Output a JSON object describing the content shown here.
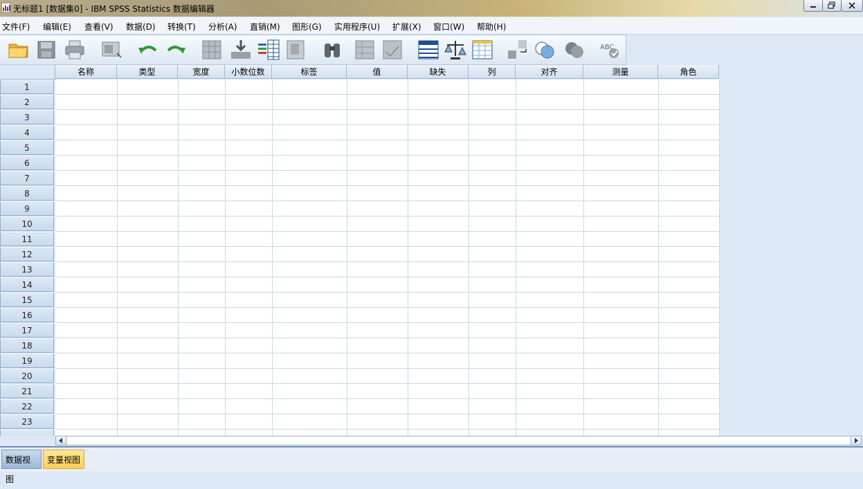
{
  "window": {
    "title": "无标题1 [数据集0] - IBM SPSS Statistics 数据编辑器"
  },
  "menu": [
    {
      "label": "文件(F)"
    },
    {
      "label": "编辑(E)"
    },
    {
      "label": "查看(V)"
    },
    {
      "label": "数据(D)"
    },
    {
      "label": "转换(T)"
    },
    {
      "label": "分析(A)"
    },
    {
      "label": "直销(M)"
    },
    {
      "label": "图形(G)"
    },
    {
      "label": "实用程序(U)"
    },
    {
      "label": "扩展(X)"
    },
    {
      "label": "窗口(W)"
    },
    {
      "label": "帮助(H)"
    }
  ],
  "toolbar": [
    "open-folder-icon",
    "save-icon",
    "print-icon",
    "dialog-recall-icon",
    "undo-icon",
    "redo-icon",
    "goto-case-icon",
    "goto-variable-icon",
    "variables-icon",
    "run-descriptives-icon",
    "find-icon",
    "insert-cases-icon",
    "insert-variable-icon",
    "split-file-icon",
    "weight-cases-icon",
    "select-cases-icon",
    "value-labels-icon",
    "use-variable-sets-icon",
    "show-all-variables-icon",
    "spell-check-icon"
  ],
  "grid": {
    "columns": [
      "名称",
      "类型",
      "宽度",
      "小数位数",
      "标签",
      "值",
      "缺失",
      "列",
      "对齐",
      "测量",
      "角色"
    ],
    "rows": [
      "1",
      "2",
      "3",
      "4",
      "5",
      "6",
      "7",
      "8",
      "9",
      "10",
      "11",
      "12",
      "13",
      "14",
      "15",
      "16",
      "17",
      "18",
      "19",
      "20",
      "21",
      "22",
      "23"
    ]
  },
  "tabs": {
    "data_view": "数据视图",
    "variable_view": "变量视图",
    "active": "variable_view"
  },
  "colors": {
    "active_tab": "#ffd86a",
    "grid_line": "#c6d8e6",
    "header_bg": "#d2e0ef"
  }
}
